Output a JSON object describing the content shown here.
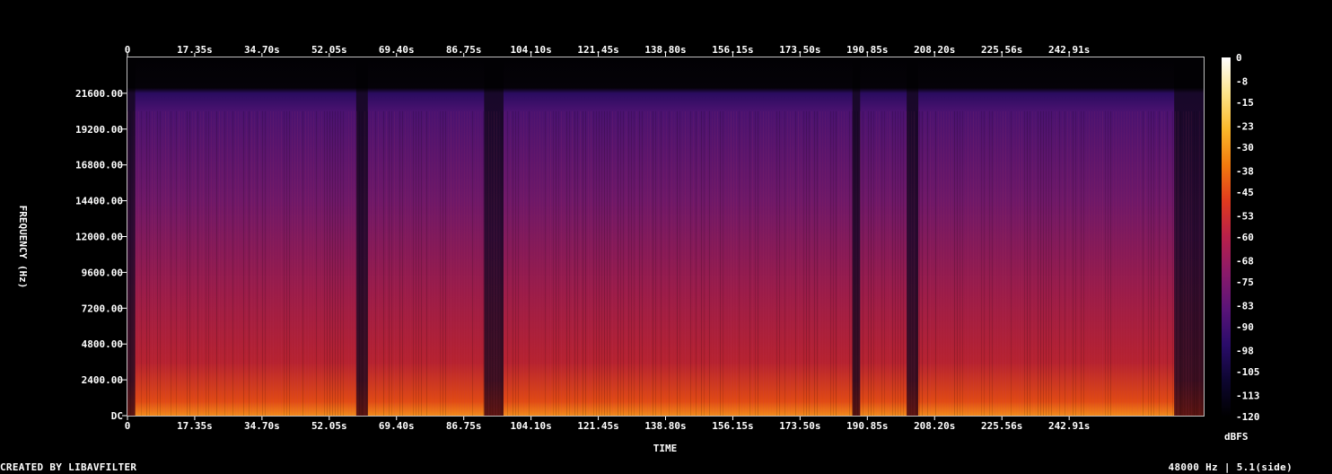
{
  "chart_data": {
    "type": "heatmap",
    "title": "",
    "xlabel": "TIME",
    "ylabel": "FREQUENCY (Hz)",
    "x_ticks": [
      "0",
      "17.35s",
      "34.70s",
      "52.05s",
      "69.40s",
      "86.75s",
      "104.10s",
      "121.45s",
      "138.80s",
      "156.15s",
      "173.50s",
      "190.85s",
      "208.20s",
      "225.56s",
      "242.91s"
    ],
    "x_tick_values": [
      0,
      17.35,
      34.7,
      52.05,
      69.4,
      86.75,
      104.1,
      121.45,
      138.8,
      156.15,
      173.5,
      190.85,
      208.2,
      225.56,
      242.91
    ],
    "xlim": [
      0,
      277.6
    ],
    "y_ticks": [
      "DC",
      "2400.00",
      "4800.00",
      "7200.00",
      "9600.00",
      "12000.00",
      "14400.00",
      "16800.00",
      "19200.00",
      "21600.00"
    ],
    "y_tick_values": [
      0,
      2400,
      4800,
      7200,
      9600,
      12000,
      14400,
      16800,
      19200,
      21600
    ],
    "ylim": [
      0,
      24000
    ],
    "colorbar": {
      "label": "dBFS",
      "ticks": [
        "0",
        "-8",
        "-15",
        "-23",
        "-30",
        "-38",
        "-45",
        "-53",
        "-60",
        "-68",
        "-75",
        "-83",
        "-90",
        "-98",
        "-105",
        "-113",
        "-120"
      ],
      "tick_values": [
        0,
        -8,
        -15,
        -23,
        -30,
        -38,
        -45,
        -53,
        -60,
        -68,
        -75,
        -83,
        -90,
        -98,
        -105,
        -113,
        -120
      ],
      "range": [
        -120,
        0
      ],
      "colors": [
        "#000000",
        "#0d0630",
        "#2a0c6a",
        "#5a1478",
        "#8a1a6a",
        "#b8204a",
        "#e03a1e",
        "#f27a0e",
        "#fbb82a",
        "#fde58a",
        "#ffffff"
      ]
    },
    "content_cutoff_hz": 20400,
    "quiet_segments_s": [
      [
        0,
        2
      ],
      [
        59,
        62
      ],
      [
        92,
        97
      ],
      [
        187,
        189
      ],
      [
        201,
        204
      ],
      [
        270,
        277.6
      ]
    ],
    "accent": "#ffffff"
  },
  "footer": {
    "left": "CREATED BY LIBAVFILTER",
    "right": "48000 Hz | 5.1(side)"
  }
}
